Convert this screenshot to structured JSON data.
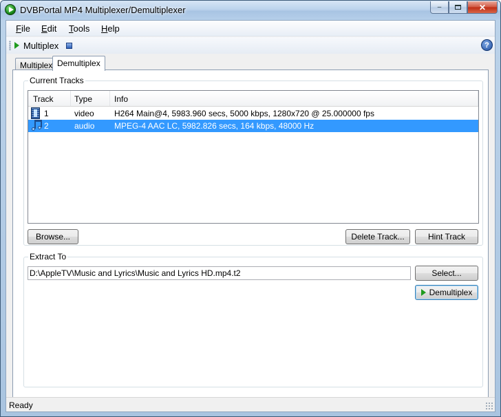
{
  "window": {
    "title": "DVBPortal MP4 Multiplexer/Demultiplexer"
  },
  "menu": [
    {
      "label": "File",
      "accel": "F",
      "rest": "ile"
    },
    {
      "label": "Edit",
      "accel": "E",
      "rest": "dit"
    },
    {
      "label": "Tools",
      "accel": "T",
      "rest": "ools"
    },
    {
      "label": "Help",
      "accel": "H",
      "rest": "elp"
    }
  ],
  "toolbar": {
    "multiplex_label": "Multiplex",
    "help_symbol": "?"
  },
  "tabs": [
    {
      "label": "Multiplex",
      "active": false
    },
    {
      "label": "Demultiplex",
      "active": true
    }
  ],
  "current_tracks": {
    "group_label": "Current Tracks",
    "columns": [
      "Track",
      "Type",
      "Info"
    ],
    "rows": [
      {
        "track": "1",
        "type": "video",
        "info": "H264 Main@4, 5983.960 secs, 5000 kbps, 1280x720 @ 25.000000 fps",
        "icon": "film-icon",
        "selected": false
      },
      {
        "track": "2",
        "type": "audio",
        "info": "MPEG-4 AAC LC, 5982.826 secs, 164 kbps, 48000 Hz",
        "icon": "music-note-icon",
        "selected": true
      }
    ],
    "browse_label": "Browse...",
    "delete_label": "Delete Track...",
    "hint_label": "Hint Track"
  },
  "extract": {
    "group_label": "Extract To",
    "path": "D:\\AppleTV\\Music and Lyrics\\Music and Lyrics HD.mp4.t2",
    "select_label": "Select...",
    "demux_label": "Demultiplex"
  },
  "status": {
    "text": "Ready"
  },
  "colors": {
    "selection": "#3399ff",
    "play_green": "#1f9b1f"
  }
}
